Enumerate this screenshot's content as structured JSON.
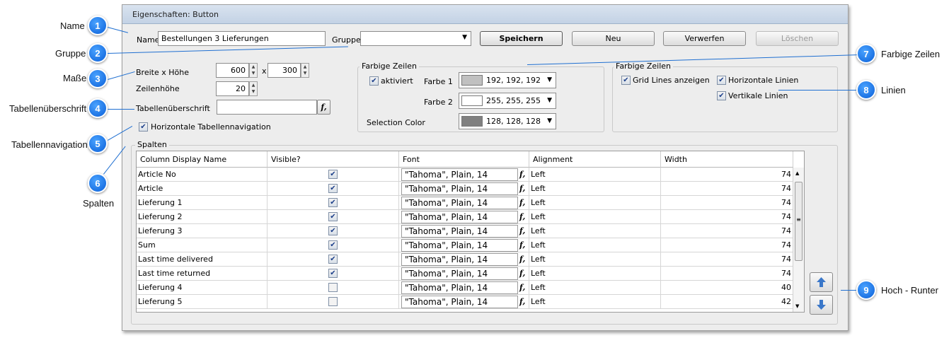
{
  "window": {
    "title": "Eigenschaften: Button"
  },
  "callouts": [
    {
      "n": "1",
      "label": "Name"
    },
    {
      "n": "2",
      "label": "Gruppe"
    },
    {
      "n": "3",
      "label": "Maße"
    },
    {
      "n": "4",
      "label": "Tabellenüberschrift"
    },
    {
      "n": "5",
      "label": "Tabellennavigation"
    },
    {
      "n": "6",
      "label": "Spalten"
    },
    {
      "n": "7",
      "label": "Farbige Zeilen"
    },
    {
      "n": "8",
      "label": "Linien"
    },
    {
      "n": "9",
      "label": "Hoch - Runter"
    }
  ],
  "top": {
    "name_label": "Name",
    "name_value": "Bestellungen 3 Lieferungen",
    "group_label": "Gruppe",
    "group_value": "",
    "buttons": {
      "save": "Speichern",
      "new": "Neu",
      "discard": "Verwerfen",
      "delete": "Löschen"
    }
  },
  "size": {
    "label": "Breite x Höhe",
    "width": "600",
    "x": "x",
    "height": "300",
    "row_height_label": "Zeilenhöhe",
    "row_height": "20",
    "caption_label": "Tabellenüberschrift",
    "caption_value": "",
    "nav_label": "Horizontale Tabellennavigation",
    "nav_checked": true
  },
  "colored_rows": {
    "title": "Farbige Zeilen",
    "enabled_label": "aktiviert",
    "color1_label": "Farbe 1",
    "color1_value": "192, 192, 192",
    "color1_hex": "#c0c0c0",
    "color2_label": "Farbe 2",
    "color2_value": "255, 255, 255",
    "color2_hex": "#ffffff",
    "selection_label": "Selection Color",
    "selection_value": "128, 128, 128",
    "selection_hex": "#808080"
  },
  "lines": {
    "title": "Farbige Zeilen",
    "grid_label": "Grid Lines anzeigen",
    "horizontal_label": "Horizontale Linien",
    "vertical_label": "Vertikale Linien"
  },
  "columns": {
    "title": "Spalten",
    "headers": [
      "Column Display Name",
      "Visible?",
      "Font",
      "Alignment",
      "Width"
    ],
    "rows": [
      {
        "name": "Article No",
        "visible": true,
        "font": "\"Tahoma\", Plain, 14",
        "align": "Left",
        "width": "74"
      },
      {
        "name": "Article",
        "visible": true,
        "font": "\"Tahoma\", Plain, 14",
        "align": "Left",
        "width": "74"
      },
      {
        "name": "Lieferung 1",
        "visible": true,
        "font": "\"Tahoma\", Plain, 14",
        "align": "Left",
        "width": "74"
      },
      {
        "name": "Lieferung 2",
        "visible": true,
        "font": "\"Tahoma\", Plain, 14",
        "align": "Left",
        "width": "74"
      },
      {
        "name": "Lieferung 3",
        "visible": true,
        "font": "\"Tahoma\", Plain, 14",
        "align": "Left",
        "width": "74"
      },
      {
        "name": "Sum",
        "visible": true,
        "font": "\"Tahoma\", Plain, 14",
        "align": "Left",
        "width": "74"
      },
      {
        "name": "Last time delivered",
        "visible": true,
        "font": "\"Tahoma\", Plain, 14",
        "align": "Left",
        "width": "74"
      },
      {
        "name": "Last time returned",
        "visible": true,
        "font": "\"Tahoma\", Plain, 14",
        "align": "Left",
        "width": "74"
      },
      {
        "name": "Lieferung 4",
        "visible": false,
        "font": "\"Tahoma\", Plain, 14",
        "align": "Left",
        "width": "40"
      },
      {
        "name": "Lieferung 5",
        "visible": false,
        "font": "\"Tahoma\", Plain, 14",
        "align": "Left",
        "width": "42"
      }
    ]
  }
}
